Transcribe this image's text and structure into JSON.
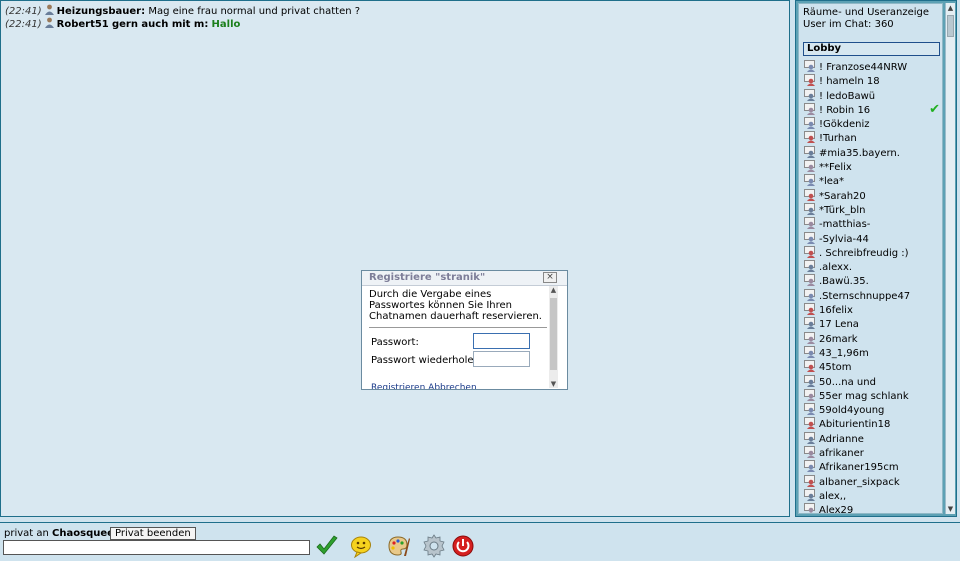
{
  "messages": [
    {
      "time": "(22:41)",
      "nick": "Heizungsbauer:",
      "text": "Mag eine frau normal und privat chatten ?",
      "target": ""
    },
    {
      "time": "(22:41)",
      "nick": "Robert51",
      "text": "gern auch mit m:",
      "target": "Hallo"
    }
  ],
  "rooms_panel": {
    "title": "Räume- und Useranzeige",
    "user_count": "User im Chat: 360",
    "room": "Lobby",
    "users": [
      "! Franzose44NRW",
      "! hameln 18",
      "! ledoBawü",
      "! Robin 16",
      "!Gökdeniz",
      "!Turhan",
      "#mia35.bayern.",
      "**Felix",
      "*lea*",
      "*Sarah20",
      "*Türk_bln",
      "-matthias-",
      "-Sylvia-44",
      ". Schreibfreudig :)",
      ".alexx.",
      ".Bawü.35.",
      ".Sternschnuppe47",
      "16felix",
      "17 Lena",
      "26mark",
      "43_1,96m",
      "45tom",
      "50...na und",
      "55er mag schlank",
      "59old4young",
      "Abiturientin18",
      "Adrianne",
      "afrikaner",
      "Afrikaner195cm",
      "albaner_sixpack",
      "alex,,",
      "Alex29"
    ]
  },
  "dialog": {
    "title": "Registriere \"stranik\"",
    "close": "×",
    "text": "Durch die Vergabe eines Passwortes können Sie Ihren Chatnamen dauerhaft reservieren.",
    "password_label": "Passwort:",
    "password_repeat_label": "Passwort wiederholen:",
    "links": "Registrieren    Abbrechen"
  },
  "bottom": {
    "private_prefix": "privat an",
    "private_target": "Chaosqueen",
    "end_private": "Privat beenden"
  },
  "colors": {
    "accent": "#1f6f8b",
    "nick_target": "#1b7f1b",
    "check": "#20b020"
  }
}
